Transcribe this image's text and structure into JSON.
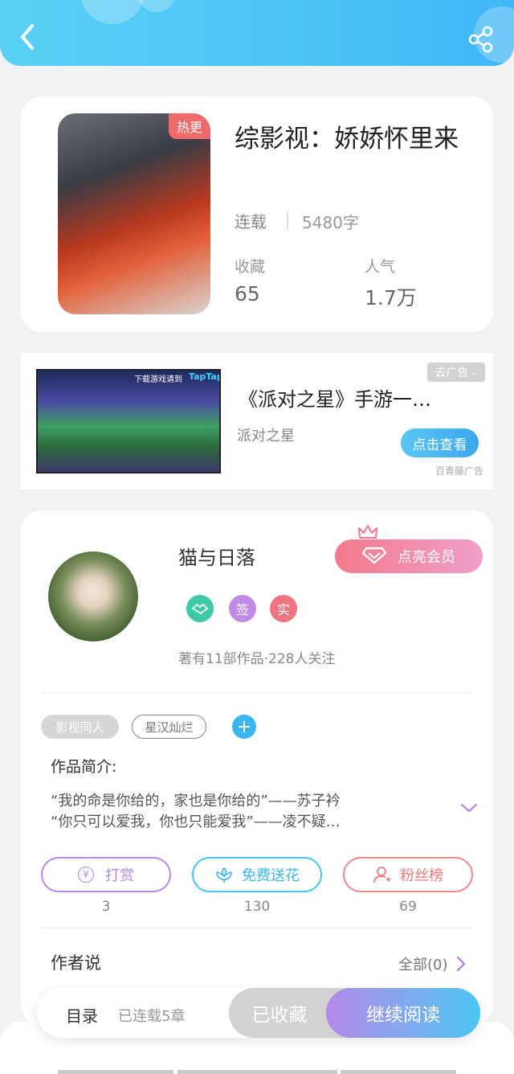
{
  "header": {
    "back_icon": "back-arrow-icon",
    "share_icon": "share-icon"
  },
  "book": {
    "hot_tag": "热更",
    "title": "综影视：娇娇怀里来",
    "status": "连载",
    "word_count": "5480字",
    "favorites_label": "收藏",
    "favorites_value": "65",
    "popularity_label": "人气",
    "popularity_value": "1.7万"
  },
  "ad": {
    "close_label": "去广告",
    "title": "《派对之星》手游一…",
    "source": "派对之星",
    "cta": "点击查看",
    "footer": "百青藤广告",
    "image_text_1": "下载游戏请到",
    "image_text_2": "TapTap"
  },
  "author": {
    "name": "猫与日落",
    "vip_button": "点亮会员",
    "badge_sign": "签",
    "badge_real": "实",
    "stats": "著有11部作品·228人关注"
  },
  "tags": [
    "影视同人",
    "星汉灿烂"
  ],
  "intro": {
    "label": "作品简介:",
    "line1": "“我的命是你给的，家也是你给的”——苏子衿",
    "line2": "“你只可以爱我，你也只能爱我”——凌不疑…"
  },
  "actions": {
    "reward_label": "打赏",
    "reward_count": "3",
    "flower_label": "免费送花",
    "flower_count": "130",
    "fans_label": "粉丝榜",
    "fans_count": "69"
  },
  "author_says": {
    "label": "作者说",
    "all": "全部(0)"
  },
  "bottom": {
    "catalog": "目录",
    "chapters": "已连载5章",
    "collected": "已收藏",
    "continue": "继续阅读"
  },
  "colors": {
    "header": "#4cc3f6",
    "vip": "#f37a8c",
    "reward": "#b48ae8",
    "flower": "#4cc3f6",
    "fans": "#f08a8a"
  }
}
